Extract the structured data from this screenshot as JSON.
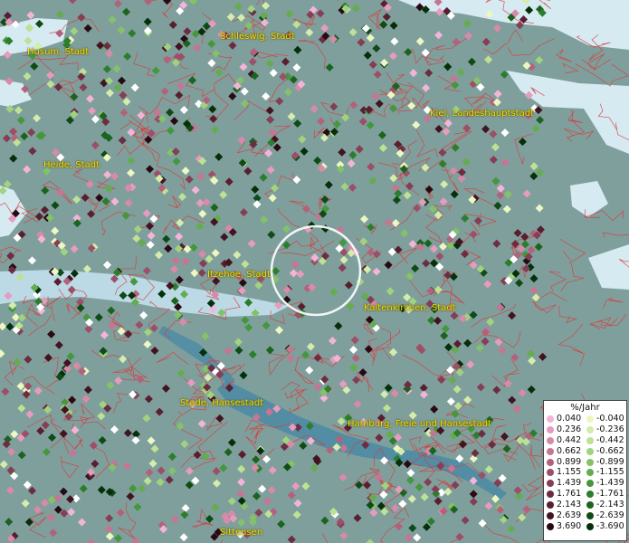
{
  "map": {
    "places": [
      {
        "name": "Husum, Stadt"
      },
      {
        "name": "Schleswig, Stadt"
      },
      {
        "name": "Kiel, Landeshauptstadt"
      },
      {
        "name": "Heide, Stadt"
      },
      {
        "name": "Itzehoe, Stadt"
      },
      {
        "name": "Kaltenkirchen, Stadt"
      },
      {
        "name": "Stade, Hansestadt"
      },
      {
        "name": "Hamburg, Freie und Hansestadt"
      },
      {
        "name": "Sittensen"
      }
    ]
  },
  "legend": {
    "title": "%/Jahr",
    "positive": [
      {
        "label": "0.040",
        "color": "#f4b4d8"
      },
      {
        "label": "0.236",
        "color": "#e79bbd"
      },
      {
        "label": "0.442",
        "color": "#d98aa8"
      },
      {
        "label": "0.662",
        "color": "#c77592"
      },
      {
        "label": "0.899",
        "color": "#b3627c"
      },
      {
        "label": "1.155",
        "color": "#9c4f67"
      },
      {
        "label": "1.439",
        "color": "#853e54"
      },
      {
        "label": "1.761",
        "color": "#6d2c41"
      },
      {
        "label": "2.143",
        "color": "#581f30"
      },
      {
        "label": "2.639",
        "color": "#421320"
      },
      {
        "label": "3.690",
        "color": "#2a0a12"
      }
    ],
    "negative": [
      {
        "label": "-0.040",
        "color": "#ecf7c2"
      },
      {
        "label": "-0.236",
        "color": "#d4edaa"
      },
      {
        "label": "-0.442",
        "color": "#bde293"
      },
      {
        "label": "-0.662",
        "color": "#a1d37e"
      },
      {
        "label": "-0.899",
        "color": "#83c268"
      },
      {
        "label": "-1.155",
        "color": "#63ad50"
      },
      {
        "label": "-1.439",
        "color": "#45973d"
      },
      {
        "label": "-1.761",
        "color": "#2d7e2c"
      },
      {
        "label": "-2.143",
        "color": "#1b641f"
      },
      {
        "label": "-2.639",
        "color": "#0f4b15"
      },
      {
        "label": "-3.690",
        "color": "#06300a"
      }
    ]
  },
  "colors": {
    "land": "#7f9f9c",
    "water": "#d6eaf2",
    "borders": "#d93a3a",
    "label": "#e8e800",
    "highlight": "#ffffff"
  }
}
